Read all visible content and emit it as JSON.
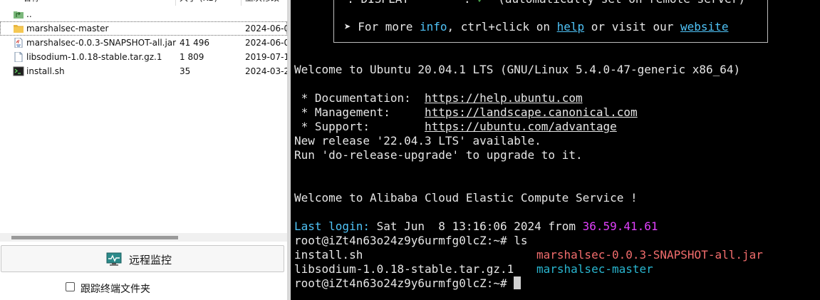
{
  "file_panel": {
    "columns": {
      "name": "名称",
      "size": "大小 (KB)",
      "modified": "上次修改"
    },
    "files": [
      {
        "name": "..",
        "size": "",
        "modified": "",
        "icon": "parent-folder-icon"
      },
      {
        "name": "marshalsec-master",
        "size": "",
        "modified": "2024-06-0",
        "icon": "folder-icon"
      },
      {
        "name": "marshalsec-0.0.3-SNAPSHOT-all.jar",
        "size": "41 496",
        "modified": "2024-06-0",
        "icon": "java-file-icon"
      },
      {
        "name": "libsodium-1.0.18-stable.tar.gz.1",
        "size": "1 809",
        "modified": "2019-07-1",
        "icon": "file-icon"
      },
      {
        "name": "install.sh",
        "size": "35",
        "modified": "2024-03-2",
        "icon": "terminal-script-icon"
      }
    ],
    "monitor_button": "远程监控",
    "follow_terminal_folder": "跟踪终端文件夹"
  },
  "terminal": {
    "box_line1": {
      "prefix": "  : DISPLAY",
      "sep": "        : ",
      "check": "✓",
      "rest": "  (automatically set on remote server)"
    },
    "box_line2": {
      "arrow": "➤ For more ",
      "info": "info",
      "mid": ", ctrl+click on ",
      "help": "help",
      "mid2": " or visit our ",
      "website": "website"
    },
    "welcome": "Welcome to Ubuntu 20.04.1 LTS (GNU/Linux 5.4.0-47-generic x86_64)",
    "doc_label": " * Documentation:  ",
    "doc_url": "https://help.ubuntu.com",
    "mgmt_label": " * Management:     ",
    "mgmt_url": "https://landscape.canonical.com",
    "support_label": " * Support:        ",
    "support_url": "https://ubuntu.com/advantage",
    "new_release": "New release '22.04.3 LTS' available.",
    "run_upgrade": "Run 'do-release-upgrade' to upgrade to it.",
    "alibaba": "Welcome to Alibaba Cloud Elastic Compute Service !",
    "last_login_label": "Last login:",
    "last_login_time": " Sat Jun  8 13:16:06 2024 from ",
    "last_login_ip": "36.59.41.61",
    "prompt1": "root@iZt4n63o24z9y6urmfg0lcZ:~# ls",
    "ls_col1_a": "install.sh",
    "ls_col2_a": "marshalsec-0.0.3-SNAPSHOT-all.jar",
    "ls_col1_b": "libsodium-1.0.18-stable.tar.gz.1",
    "ls_col2_b": "marshalsec-master",
    "prompt2": "root@iZt4n63o24z9y6urmfg0lcZ:~# "
  },
  "colors": {
    "link_cyan": "#4fc3f7",
    "ip_pink": "#e040fb",
    "jar_red": "#f26d6d",
    "dir_teal": "#29b6d0"
  }
}
